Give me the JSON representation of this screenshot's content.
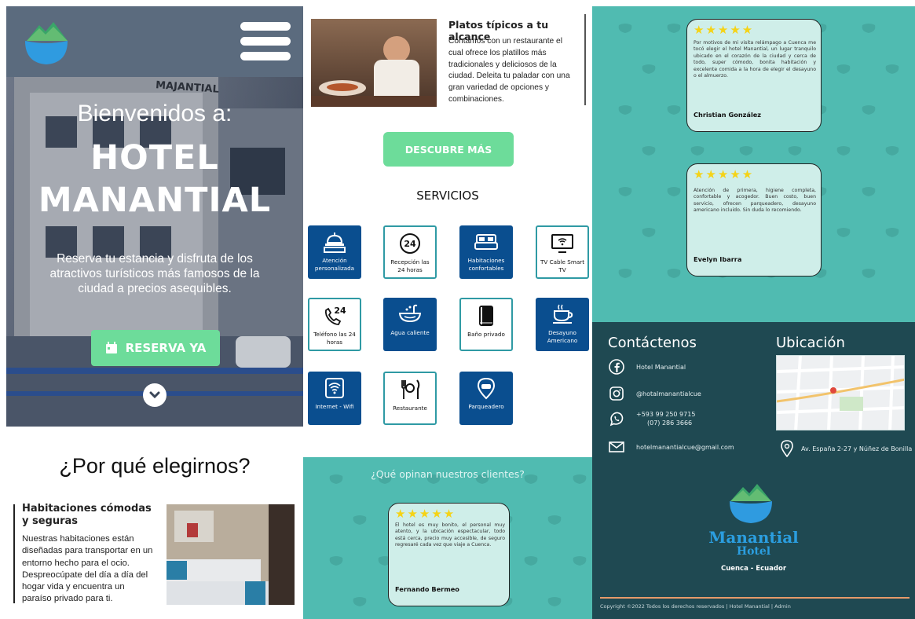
{
  "hero": {
    "welcome": "Bienvenidos a:",
    "title_line1": "HOTEL",
    "title_line2": "MANANTIAL",
    "description": "Reserva tu estancia y disfruta de los atractivos turísticos más famosos de la ciudad  a precios asequibles.",
    "reserve_label": "RESERVA YA",
    "building_sign": "MAJANTIAL"
  },
  "why": {
    "title": "¿Por qué elegirnos?",
    "subtitle": "Habitaciones cómodas y seguras",
    "text": "Nuestras habitaciones están diseñadas para transportar en un entorno hecho para el ocio. Despreocúpate del día a día del hogar vida y encuentra un paraíso privado para ti."
  },
  "food": {
    "title": "Platos típicos a tu alcance",
    "text": "Contamos con un restaurante el cual ofrece los platillos más tradicionales y deliciosos de la ciudad. Deleita tu paladar con una gran variedad de opciones y combinaciones."
  },
  "discover_label": "DESCUBRE MÁS",
  "services": {
    "title": "SERVICIOS",
    "items": [
      {
        "label": "Atención personalizada",
        "icon": "reception-bell-icon"
      },
      {
        "label": "Recepción las 24 horas",
        "icon": "clock-24-icon"
      },
      {
        "label": "Habitaciones confortables",
        "icon": "bed-icon"
      },
      {
        "label": "TV Cable Smart TV",
        "icon": "tv-icon"
      },
      {
        "label": "Teléfono las 24 horas",
        "icon": "phone-24-icon"
      },
      {
        "label": "Agua caliente",
        "icon": "bathtub-icon"
      },
      {
        "label": "Baño privado",
        "icon": "toilet-icon"
      },
      {
        "label": "Desayuno Americano",
        "icon": "coffee-cup-icon"
      },
      {
        "label": "Internet - Wifi",
        "icon": "wifi-icon"
      },
      {
        "label": "Restaurante",
        "icon": "cutlery-icon"
      },
      {
        "label": "Parqueadero",
        "icon": "car-pin-icon"
      }
    ]
  },
  "reviews": {
    "title": "¿Qué opinan nuestros clientes?",
    "stars": "★★★★★",
    "watermark_word": "Manantial",
    "watermark_sub": "Hotel",
    "items": [
      {
        "text": "El hotel es muy bonito, el personal muy atento, y la ubicación espectacular, todo está cerca, precio muy accesible, de seguro regresaré cada vez que viaje a Cuenca.",
        "author": "Fernando Bermeo"
      },
      {
        "text": "Por motivos de mi visita relámpago a Cuenca me tocó elegir el hotel Manantial, un lugar tranquilo ubicado en el corazón de la ciudad y cerca de todo, super cómodo, bonita habitación y excelente comida a la hora de elegir el desayuno o el almuerzo.",
        "author": "Christian González"
      },
      {
        "text": "Atención de primera, higiene completa, confortable y acogedor. Buen costo, buen servicio, ofrecen parqueadero, desayuno americano incluido. Sin duda lo recomiendo.",
        "author": "Evelyn Ibarra"
      }
    ]
  },
  "footer": {
    "contact_title": "Contáctenos",
    "location_title": "Ubicación",
    "facebook": "Hotel Manantial",
    "instagram": "@hotalmanantialcue",
    "phone1": "+593 99 250 9715",
    "phone2": "(07) 286 3666",
    "email": "hotelmanantialcue@gmail.com",
    "address": "Av. España 2-27 y Núñez de Bonilla",
    "brand_line1": "Manantial",
    "brand_line2": "Hotel",
    "city": "Cuenca - Ecuador",
    "copyright": "Copyright ©2022 Todos los derechos reservados | Hotel Manantial | Admin"
  },
  "colors": {
    "accent_green": "#6ddc9a",
    "service_blue": "#0a4e8f",
    "teal": "#50bbb1",
    "footer_dark": "#1f4952",
    "star_yellow": "#f5d316"
  }
}
